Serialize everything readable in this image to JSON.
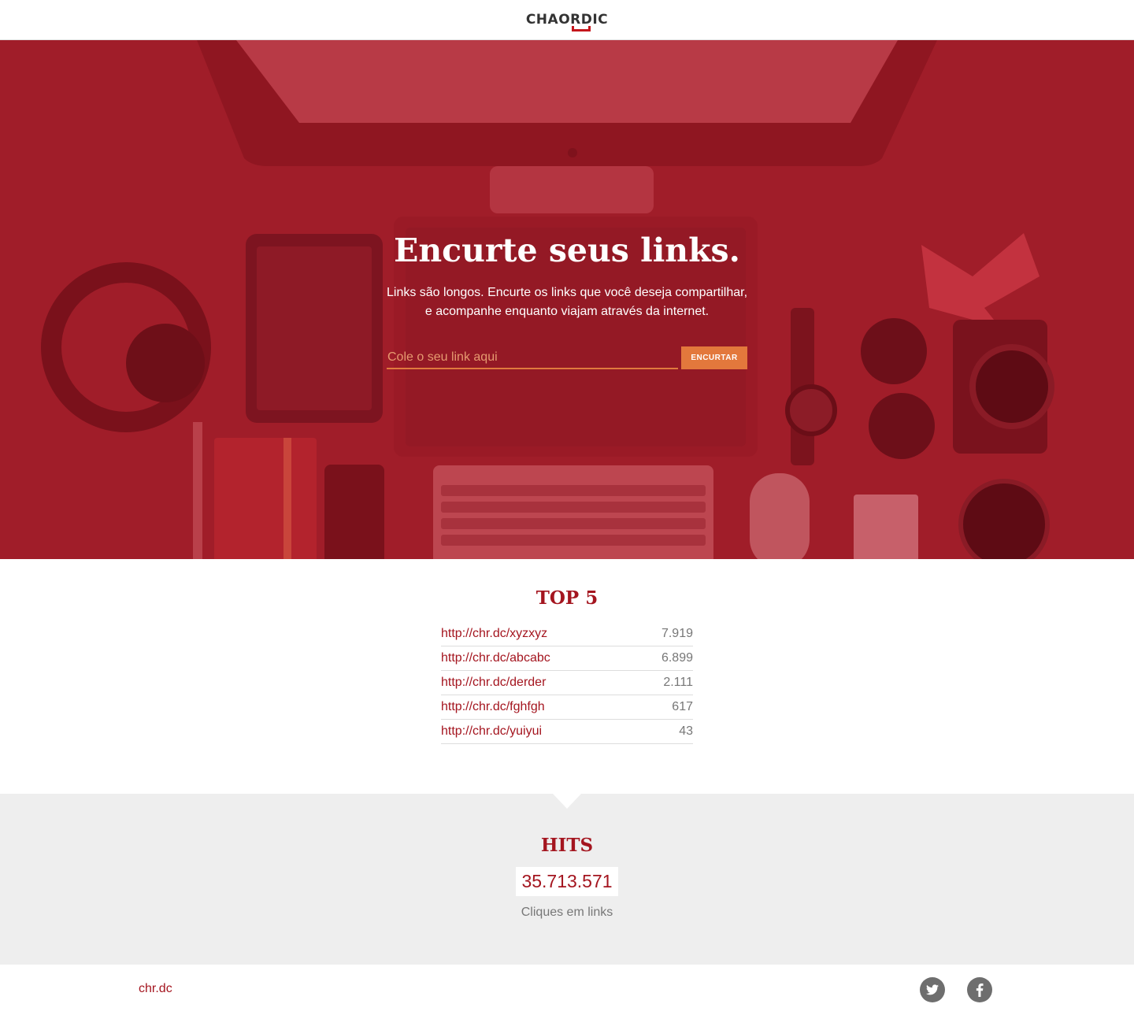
{
  "header": {
    "logo_text": "CHAORDIC"
  },
  "hero": {
    "title": "Encurte seus links.",
    "subtitle_line1": "Links são longos. Encurte os links que você deseja compartilhar,",
    "subtitle_line2": "e acompanhe enquanto viajam através da internet.",
    "input_placeholder": "Cole o seu link aqui",
    "input_value": "",
    "button_label": "ENCURTAR",
    "overlay_color": "#a31b27"
  },
  "top5": {
    "title": "TOP 5",
    "items": [
      {
        "url": "http://chr.dc/xyzxyz",
        "count": "7.919"
      },
      {
        "url": "http://chr.dc/abcabc",
        "count": "6.899"
      },
      {
        "url": "http://chr.dc/derder",
        "count": "2.111"
      },
      {
        "url": "http://chr.dc/fghfgh",
        "count": "617"
      },
      {
        "url": "http://chr.dc/yuiyui",
        "count": "43"
      }
    ]
  },
  "hits": {
    "title": "HITS",
    "value": "35.713.571",
    "caption": "Cliques em links"
  },
  "footer": {
    "link_text": "chr.dc",
    "social": [
      {
        "name": "twitter-icon"
      },
      {
        "name": "facebook-icon"
      }
    ]
  },
  "colors": {
    "brand_red": "#a4151f",
    "accent_orange": "#e3783c",
    "gray_band": "#eeeeee"
  }
}
